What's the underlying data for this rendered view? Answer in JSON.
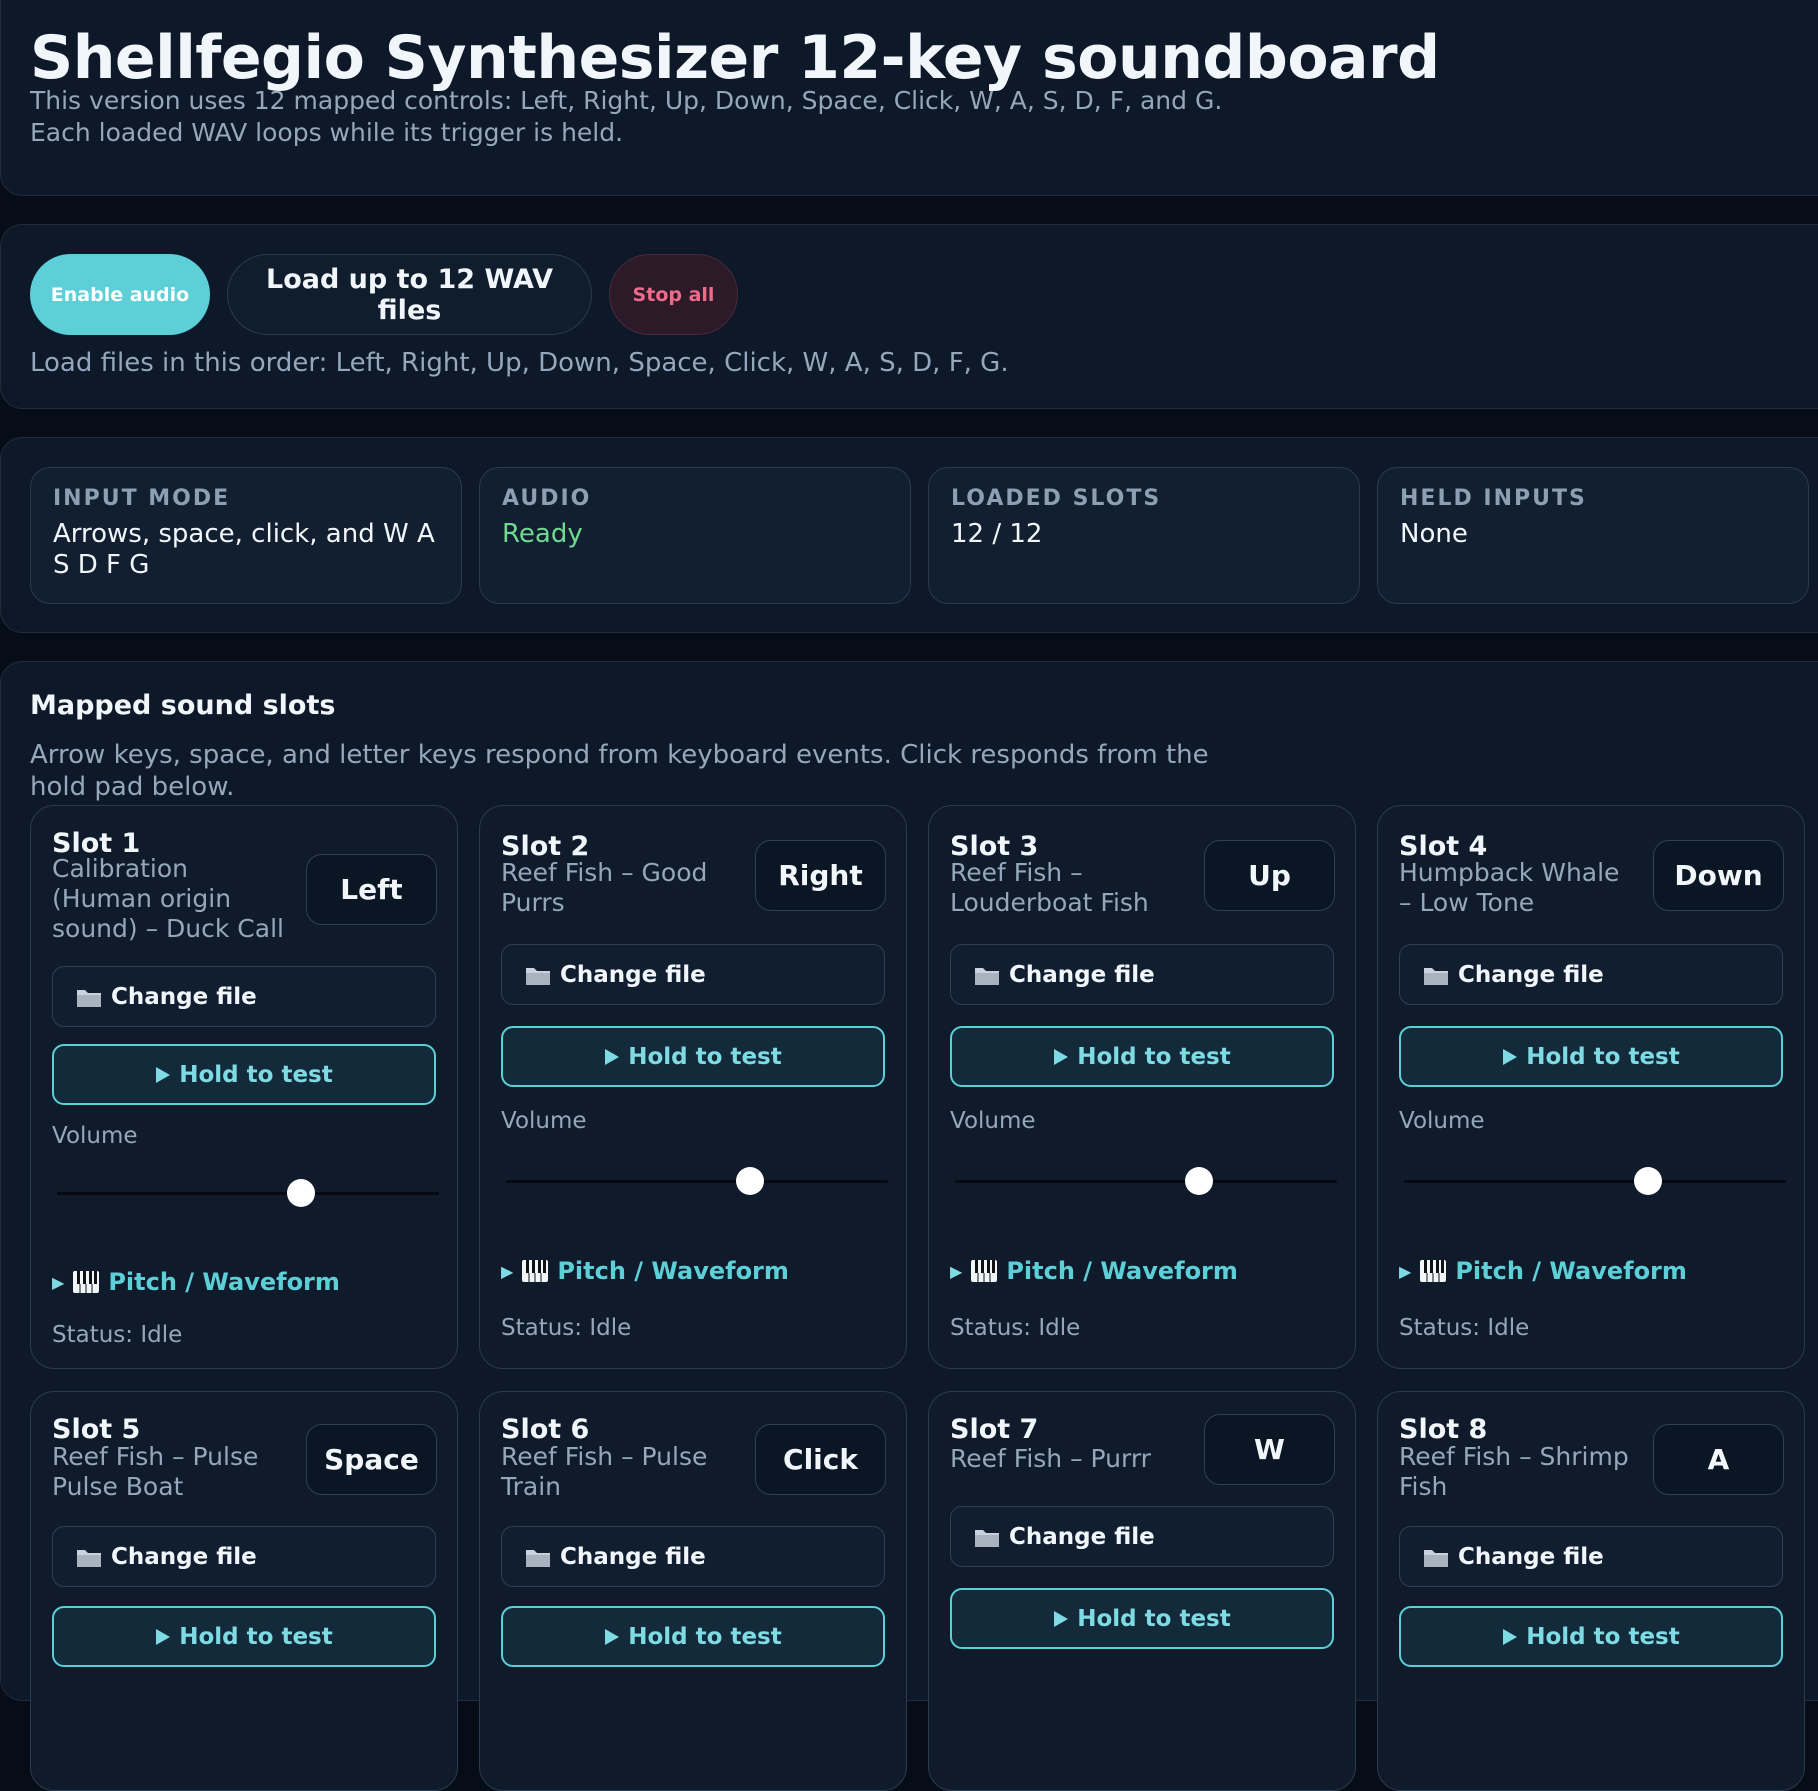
{
  "header": {
    "title": "Shellfegio Synthesizer 12-key soundboard",
    "subtitle": "This version uses 12 mapped controls: Left, Right, Up, Down, Space, Click, W, A, S, D, F, and G. Each loaded WAV loops while its trigger is held."
  },
  "controls": {
    "enable_label": "Enable audio",
    "load_label": "Load up to 12 WAV files",
    "stop_label": "Stop all",
    "hint": "Load files in this order: Left, Right, Up, Down, Space, Click, W, A, S, D, F, G."
  },
  "status": [
    {
      "label": "INPUT MODE",
      "value": "Arrows, space, click, and W A S D F G"
    },
    {
      "label": "AUDIO",
      "value": "Ready"
    },
    {
      "label": "LOADED SLOTS",
      "value": "12 / 12"
    },
    {
      "label": "HELD INPUTS",
      "value": "None"
    }
  ],
  "colors": {
    "accent": "#5dcfd7",
    "ready": "#6fd98f",
    "stop": "#f06b8a",
    "background": "#070d16",
    "panel": "#0d1828"
  },
  "slots_section": {
    "title": "Mapped sound slots",
    "description": "Arrow keys, space, and letter keys respond from keyboard events. Click responds from the hold pad below."
  },
  "slot_ui": {
    "change_label": "Change file",
    "hold_label": "Hold to test",
    "volume_label": "Volume",
    "pitch_label": "Pitch / Waveform",
    "folder_icon": "folder-icon",
    "play_icon": "play-icon",
    "piano_icon": "piano-icon"
  },
  "slots": [
    {
      "title": "Slot 1",
      "sound": "Calibration (Human origin sound) – Duck Call",
      "key": "Left",
      "status": "Status: Idle",
      "volume": 0.64
    },
    {
      "title": "Slot 2",
      "sound": "Reef Fish – Good Purrs",
      "key": "Right",
      "status": "Status: Idle",
      "volume": 0.64
    },
    {
      "title": "Slot 3",
      "sound": "Reef Fish – Louderboat Fish",
      "key": "Up",
      "status": "Status: Idle",
      "volume": 0.64
    },
    {
      "title": "Slot 4",
      "sound": "Humpback Whale – Low Tone",
      "key": "Down",
      "status": "Status: Idle",
      "volume": 0.64
    },
    {
      "title": "Slot 5",
      "sound": "Reef Fish – Pulse Pulse Boat",
      "key": "Space"
    },
    {
      "title": "Slot 6",
      "sound": "Reef Fish – Pulse Train",
      "key": "Click"
    },
    {
      "title": "Slot 7",
      "sound": "Reef Fish – Purrr",
      "key": "W"
    },
    {
      "title": "Slot 8",
      "sound": "Reef Fish – Shrimp Fish",
      "key": "A"
    }
  ]
}
